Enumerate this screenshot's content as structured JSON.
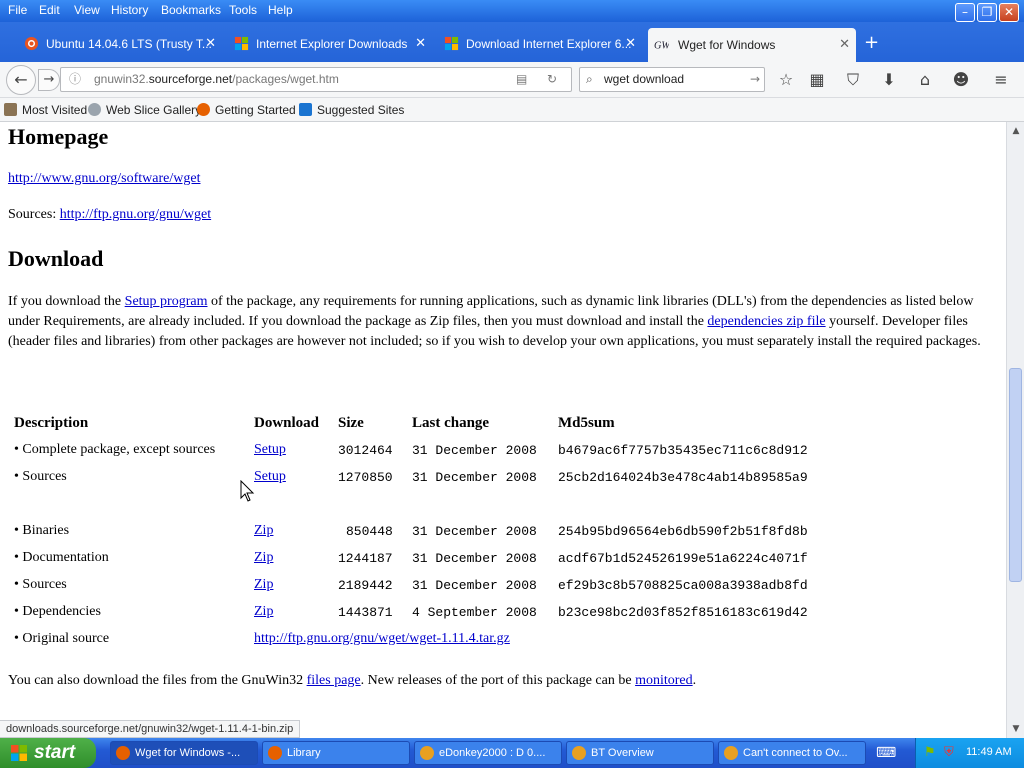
{
  "menu": [
    "File",
    "Edit",
    "View",
    "History",
    "Bookmarks",
    "Tools",
    "Help"
  ],
  "tabs": [
    {
      "label": "Ubuntu 14.04.6 LTS (Trusty T...",
      "icon": "ubuntu-icon"
    },
    {
      "label": "Internet Explorer Downloads",
      "icon": "windows-logo-icon"
    },
    {
      "label": "Download Internet Explorer 6...",
      "icon": "windows-logo-icon"
    },
    {
      "label": "Wget for Windows",
      "icon": "gnuwin-icon"
    }
  ],
  "url": {
    "domain_prefix": "gnuwin32.",
    "domain": "sourceforge.net",
    "path": "/packages/wget.htm"
  },
  "search": {
    "value": "wget download"
  },
  "bookmarks": [
    "Most Visited",
    "Web Slice Gallery",
    "Getting Started",
    "Suggested Sites"
  ],
  "page": {
    "homepage_heading": "Homepage",
    "homepage_link": "http://www.gnu.org/software/wget",
    "sources_label": "Sources:",
    "sources_link": "http://ftp.gnu.org/gnu/wget",
    "download_heading": "Download",
    "para_1": "If you download the ",
    "para_link_setup": "Setup program",
    "para_2": " of the package, any requirements for running applications, such as dynamic link libraries (DLL's) from the dependencies as listed below under Requirements, are already included. If you download the package as Zip files, then you must download and install the ",
    "para_link_deps": "dependencies zip file",
    "para_3": " yourself. Developer files (header files and libraries) from other packages are however not included; so if you wish to develop your own applications, you must separately install the required packages.",
    "table_headers": [
      "Description",
      "Download",
      "Size",
      "Last change",
      "Md5sum"
    ],
    "rows": [
      {
        "desc": "• Complete package, except sources",
        "dl": "Setup",
        "size": "3012464",
        "date": "31 December 2008",
        "md5": "b4679ac6f7757b35435ec711c6c8d912"
      },
      {
        "desc": "• Sources",
        "dl": "Setup",
        "size": "1270850",
        "date": "31 December 2008",
        "md5": "25cb2d164024b3e478c4ab14b89585a9"
      },
      {
        "desc": "• Binaries",
        "dl": "Zip",
        "size": "850448",
        "date": "31 December 2008",
        "md5": "254b95bd96564eb6db590f2b51f8fd8b"
      },
      {
        "desc": "• Documentation",
        "dl": "Zip",
        "size": "1244187",
        "date": "31 December 2008",
        "md5": "acdf67b1d524526199e51a6224c4071f"
      },
      {
        "desc": "• Sources",
        "dl": "Zip",
        "size": "2189442",
        "date": "31 December 2008",
        "md5": "ef29b3c8b5708825ca008a3938adb8fd"
      },
      {
        "desc": "• Dependencies",
        "dl": "Zip",
        "size": "1443871",
        "date": "4 September 2008",
        "md5": "b23ce98bc2d03f852f8516183c619d42"
      },
      {
        "desc": "• Original source",
        "dl": "http://ftp.gnu.org/gnu/wget/wget-1.11.4.tar.gz",
        "size": "",
        "date": "",
        "md5": ""
      }
    ],
    "footer_1": "You can also download the files from the GnuWin32 ",
    "footer_link_files": "files page",
    "footer_2": ". New releases of the port of this package can be ",
    "footer_link_monitored": "monitored",
    "footer_3": "."
  },
  "status_text": "downloads.sourceforge.net/gnuwin32/wget-1.11.4-1-bin.zip",
  "taskbar": {
    "start": "start",
    "tasks": [
      "Wget for Windows -...",
      "Library",
      "eDonkey2000 : D 0....",
      "BT Overview",
      "Can't connect to Ov..."
    ],
    "clock": "11:49 AM"
  }
}
